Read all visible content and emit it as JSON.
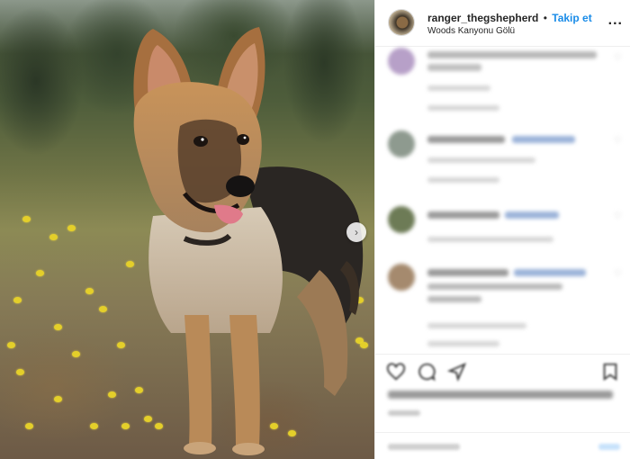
{
  "post": {
    "username": "ranger_thegshepherd",
    "separator": "•",
    "follow_label": "Takip et",
    "location": "Woods Kanyonu Gölü",
    "more_label": "...",
    "next_arrow": "›"
  },
  "comments": [],
  "actions": {
    "likes_text": "",
    "date_text": "",
    "add_comment_placeholder": "",
    "share_label": ""
  },
  "icons": {
    "like": "heart-icon",
    "comment": "comment-icon",
    "share": "share-icon",
    "save": "bookmark-icon"
  },
  "colors": {
    "follow": "#1a8ce8",
    "mention": "#4a74b8"
  }
}
